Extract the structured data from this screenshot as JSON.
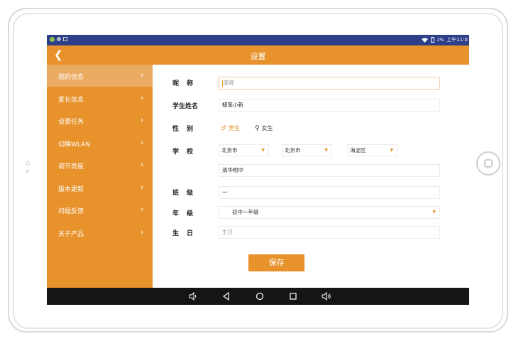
{
  "status_bar": {
    "battery": "2%",
    "time": "上午11:0"
  },
  "header": {
    "title": "设置",
    "back_icon": "chevron-left-icon"
  },
  "sidebar": {
    "items": [
      {
        "label": "我的信息",
        "active": true
      },
      {
        "label": "家长信息",
        "active": false
      },
      {
        "label": "设置任务",
        "active": false
      },
      {
        "label": "切换WLAN",
        "active": false
      },
      {
        "label": "调节亮度",
        "active": false
      },
      {
        "label": "版本更新",
        "active": false
      },
      {
        "label": "问题反馈",
        "active": false
      },
      {
        "label": "关于产品",
        "active": false
      }
    ]
  },
  "form": {
    "nickname": {
      "label": "昵　称",
      "placeholder": "昵称",
      "value": ""
    },
    "student_name": {
      "label": "学生姓名",
      "value": "蜡笔小新"
    },
    "gender": {
      "label": "性　别",
      "options": [
        "男生",
        "女生"
      ],
      "selected": "男生"
    },
    "school": {
      "label": "学　校",
      "province": "北京市",
      "city": "北京市",
      "district": "海淀区",
      "name": "清华附中"
    },
    "class": {
      "label": "班　级",
      "value": "一"
    },
    "grade": {
      "label": "年　级",
      "value": "初中一年级"
    },
    "birthday": {
      "label": "生　日",
      "placeholder": "生日",
      "value": ""
    }
  },
  "actions": {
    "save_label": "保存"
  },
  "nav_bar": {
    "icons": [
      "volume-down-icon",
      "back-triangle-icon",
      "home-circle-icon",
      "recents-square-icon",
      "volume-up-icon"
    ]
  },
  "colors": {
    "accent": "#e8922b",
    "sidebar_active": "#ebab62",
    "status_bar": "#2e3f8a",
    "nav_bar": "#151515"
  }
}
